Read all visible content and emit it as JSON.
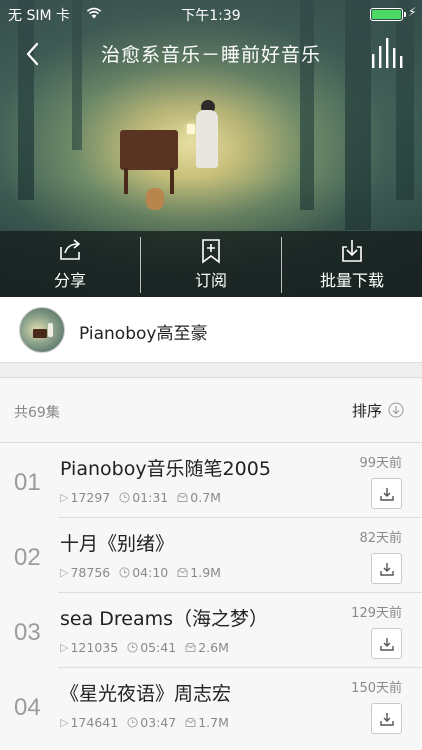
{
  "status_bar": {
    "carrier": "无 SIM 卡",
    "time": "下午1:39",
    "battery_color": "#4cd964"
  },
  "nav": {
    "title": "治愈系音乐－睡前好音乐",
    "back_icon": "chevron-left-icon",
    "right_icon": "equalizer-icon"
  },
  "actions": [
    {
      "label": "分享",
      "icon": "share-icon"
    },
    {
      "label": "订阅",
      "icon": "bookmark-plus-icon"
    },
    {
      "label": "批量下载",
      "icon": "download-icon"
    }
  ],
  "author": {
    "name": "Pianoboy高至豪"
  },
  "list": {
    "count_label": "共69集",
    "sort_label": "排序",
    "items": [
      {
        "index": "01",
        "title": "Pianoboy音乐随笔2005",
        "plays": "17297",
        "duration": "01:31",
        "size": "0.7M",
        "age": "99天前"
      },
      {
        "index": "02",
        "title": "十月《别绪》",
        "plays": "78756",
        "duration": "04:10",
        "size": "1.9M",
        "age": "82天前"
      },
      {
        "index": "03",
        "title": "sea Dreams（海之梦）",
        "plays": "121035",
        "duration": "05:41",
        "size": "2.6M",
        "age": "129天前"
      },
      {
        "index": "04",
        "title": "《星光夜语》周志宏",
        "plays": "174641",
        "duration": "03:47",
        "size": "1.7M",
        "age": "150天前"
      }
    ]
  }
}
